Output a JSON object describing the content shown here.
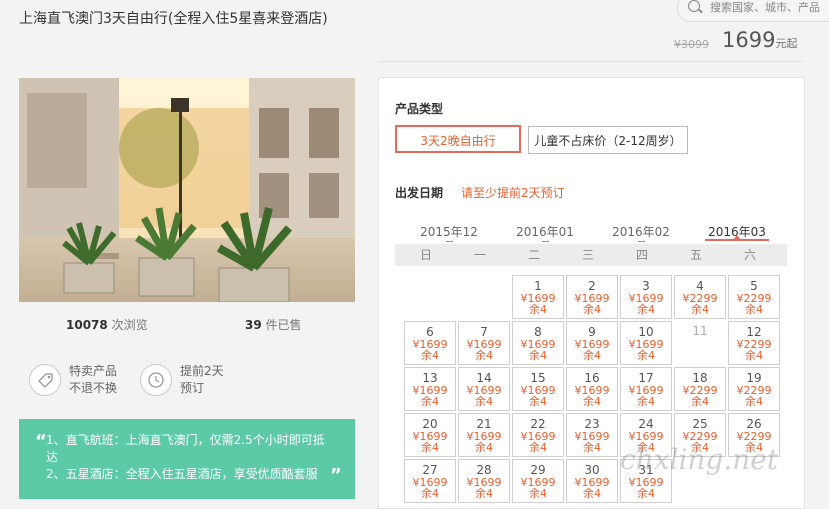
{
  "header": {
    "title": "上海直飞澳门3天自由行(全程入住5星喜来登酒店)",
    "search_placeholder": "搜索国家、城市、产品",
    "old_price": "¥3099",
    "price": "1699",
    "price_suffix": "元起"
  },
  "stats": {
    "views_count": "10078",
    "views_label": "次浏览",
    "sold_count": "39",
    "sold_label": "件已售"
  },
  "features": [
    {
      "icon": "tag-icon",
      "line1": "特卖产品",
      "line2": "不退不换"
    },
    {
      "icon": "clock-icon",
      "line1": "提前2天",
      "line2": "预订"
    }
  ],
  "highlights": {
    "line1": "1、直飞航班：上海直飞澳门，仅需2.5个小时即可抵达",
    "line2": "2、五星酒店：全程入住五星酒店，享受优质酷套服"
  },
  "booking": {
    "product_type_label": "产品类型",
    "options": [
      "3天2晚自由行",
      "儿童不占床价（2-12周岁）"
    ],
    "date_label": "出发日期",
    "date_hint": "请至少提前2天预订",
    "months": [
      "2015年12",
      "2016年01",
      "2016年02",
      "2016年03"
    ],
    "active_month_index": 3,
    "weekdays": [
      "日",
      "一",
      "二",
      "三",
      "四",
      "五",
      "六"
    ],
    "days": [
      {
        "day": "1",
        "price": "¥1699",
        "stock": "余4",
        "col": 2,
        "row": 0
      },
      {
        "day": "2",
        "price": "¥1699",
        "stock": "余4",
        "col": 3,
        "row": 0
      },
      {
        "day": "3",
        "price": "¥1699",
        "stock": "余4",
        "col": 4,
        "row": 0
      },
      {
        "day": "4",
        "price": "¥2299",
        "stock": "余4",
        "col": 5,
        "row": 0
      },
      {
        "day": "5",
        "price": "¥2299",
        "stock": "余4",
        "col": 6,
        "row": 0
      },
      {
        "day": "6",
        "price": "¥1699",
        "stock": "余4",
        "col": 0,
        "row": 1
      },
      {
        "day": "7",
        "price": "¥1699",
        "stock": "余4",
        "col": 1,
        "row": 1
      },
      {
        "day": "8",
        "price": "¥1699",
        "stock": "余4",
        "col": 2,
        "row": 1
      },
      {
        "day": "9",
        "price": "¥1699",
        "stock": "余4",
        "col": 3,
        "row": 1
      },
      {
        "day": "10",
        "price": "¥1699",
        "stock": "余4",
        "col": 4,
        "row": 1
      },
      {
        "day": "11",
        "price": "",
        "stock": "",
        "col": 5,
        "row": 1,
        "disabled": true
      },
      {
        "day": "12",
        "price": "¥2299",
        "stock": "余4",
        "col": 6,
        "row": 1
      },
      {
        "day": "13",
        "price": "¥1699",
        "stock": "余4",
        "col": 0,
        "row": 2
      },
      {
        "day": "14",
        "price": "¥1699",
        "stock": "余4",
        "col": 1,
        "row": 2
      },
      {
        "day": "15",
        "price": "¥1699",
        "stock": "余4",
        "col": 2,
        "row": 2
      },
      {
        "day": "16",
        "price": "¥1699",
        "stock": "余4",
        "col": 3,
        "row": 2
      },
      {
        "day": "17",
        "price": "¥1699",
        "stock": "余4",
        "col": 4,
        "row": 2
      },
      {
        "day": "18",
        "price": "¥2299",
        "stock": "余4",
        "col": 5,
        "row": 2
      },
      {
        "day": "19",
        "price": "¥2299",
        "stock": "余4",
        "col": 6,
        "row": 2
      },
      {
        "day": "20",
        "price": "¥1699",
        "stock": "余4",
        "col": 0,
        "row": 3
      },
      {
        "day": "21",
        "price": "¥1699",
        "stock": "余4",
        "col": 1,
        "row": 3
      },
      {
        "day": "22",
        "price": "¥1699",
        "stock": "余4",
        "col": 2,
        "row": 3
      },
      {
        "day": "23",
        "price": "¥1699",
        "stock": "余4",
        "col": 3,
        "row": 3
      },
      {
        "day": "24",
        "price": "¥1699",
        "stock": "余4",
        "col": 4,
        "row": 3
      },
      {
        "day": "25",
        "price": "¥2299",
        "stock": "余4",
        "col": 5,
        "row": 3
      },
      {
        "day": "26",
        "price": "¥2299",
        "stock": "余4",
        "col": 6,
        "row": 3
      },
      {
        "day": "27",
        "price": "¥1699",
        "stock": "余4",
        "col": 0,
        "row": 4
      },
      {
        "day": "28",
        "price": "¥1699",
        "stock": "余4",
        "col": 1,
        "row": 4
      },
      {
        "day": "29",
        "price": "¥1699",
        "stock": "余4",
        "col": 2,
        "row": 4
      },
      {
        "day": "30",
        "price": "¥1699",
        "stock": "余4",
        "col": 3,
        "row": 4
      },
      {
        "day": "31",
        "price": "¥1699",
        "stock": "余4",
        "col": 4,
        "row": 4
      }
    ]
  },
  "watermark": "chxling.net",
  "colors": {
    "accent": "#e6602f",
    "quote_bg": "#5cc9a7"
  }
}
